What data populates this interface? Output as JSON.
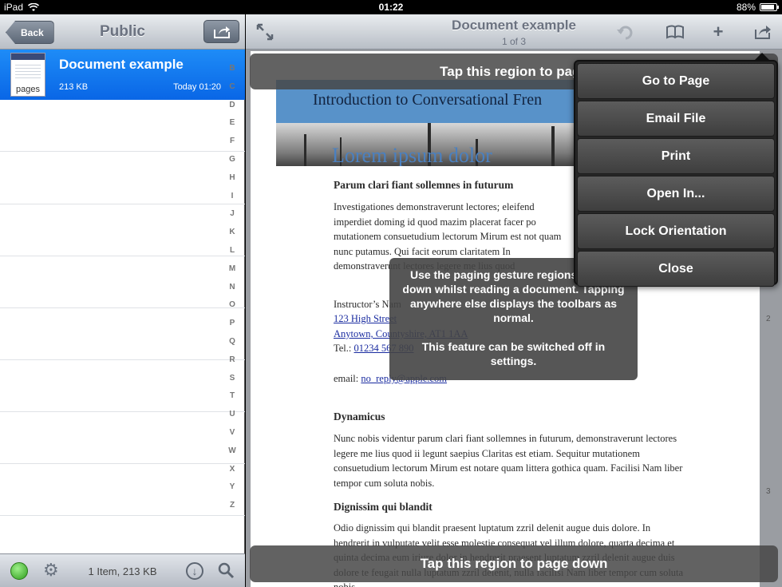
{
  "status": {
    "device": "iPad",
    "time": "01:22",
    "battery": "88%"
  },
  "left": {
    "back_label": "Back",
    "title": "Public",
    "file": {
      "name": "Document example",
      "size": "213 KB",
      "date": "Today 01:20",
      "thumb_label": "pages"
    },
    "index_letters": [
      "B",
      "C",
      "D",
      "E",
      "F",
      "G",
      "H",
      "I",
      "J",
      "K",
      "L",
      "M",
      "N",
      "O",
      "P",
      "Q",
      "R",
      "S",
      "T",
      "U",
      "V",
      "W",
      "X",
      "Y",
      "Z"
    ],
    "footer_count": "1 Item, 213 KB"
  },
  "document": {
    "title": "Document example",
    "page_indicator": "1 of 3",
    "banner_title": "Introduction to Conversational Fren",
    "banner_lorem": "Lorem ipsum dolor",
    "heading1": "Parum clari fiant sollemnes in futurum",
    "para1": "Investigationes demonstraverunt lectores; eleifend imperdiet doming id quod mazim placerat facer po mutationem consuetudium lectorum Mirum est not quam nunc putamus. Qui facit eorum claritatem In demonstraverunt lectores legere me lius quod",
    "instructor": "Instructor’s Nam",
    "address1": "123 High Street",
    "address2": "Anytown, Countyshire, AT1 1AA",
    "tel_label": "Tel.: ",
    "tel": "01234 567 890",
    "email_label": "email: ",
    "email": "no_reply@apple.com",
    "heading2": "Dynamicus",
    "para2": "Nunc nobis videntur parum clari fiant sollemnes in futurum, demonstraverunt lectores legere me lius quod ii legunt saepius Claritas est etiam. Sequitur mutationem consuetudium lectorum Mirum est notare quam littera gothica quam. Facilisi Nam liber tempor cum soluta nobis.",
    "heading3": "Dignissim qui blandit",
    "para3": "Odio dignissim qui blandit praesent luptatum zzril delenit augue duis dolore. In hendrerit in vulputate velit esse molestie consequat vel illum dolore, quarta decima et quinta decima eum iriure dolor in hendrerit praesent luptatum zzril delenit augue duis dolore te feugait nulla luptatum zzril delenit, nulla facilisi Nam liber tempor cum soluta nobis",
    "scroll_marks": [
      "2",
      "3"
    ]
  },
  "overlays": {
    "top": "Tap this region to page",
    "bottom": "Tap this region to page down",
    "tooltip_line1": "Use the paging gesture regions up and down whilst reading a document. Tapping anywhere else displays the toolbars as normal.",
    "tooltip_line2": "This feature can be switched off in settings."
  },
  "menu": {
    "items": [
      "Go to Page",
      "Email File",
      "Print",
      "Open In...",
      "Lock Orientation",
      "Close"
    ]
  }
}
